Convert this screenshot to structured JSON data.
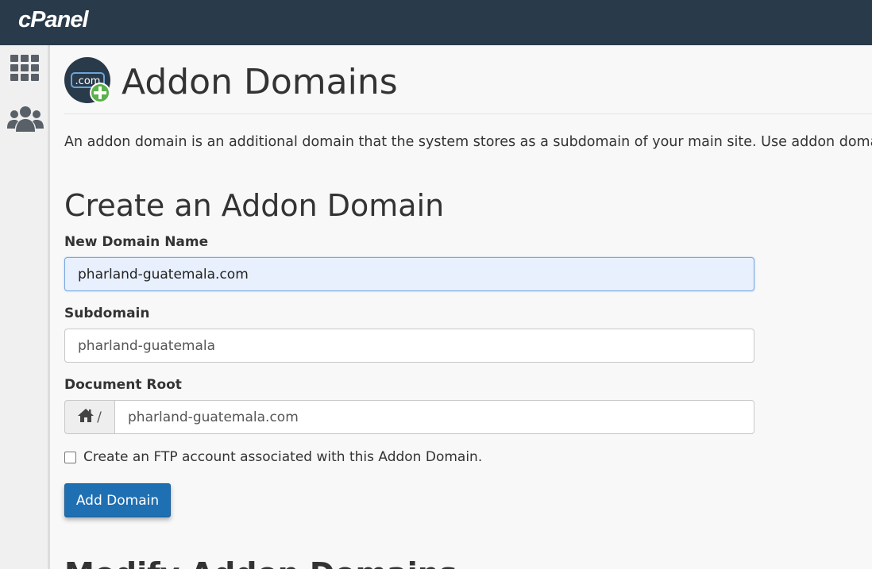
{
  "brand": {
    "logo_text": "cPanel"
  },
  "sidebar": {
    "items": [
      {
        "icon": "grid-icon"
      },
      {
        "icon": "users-icon"
      }
    ]
  },
  "page": {
    "title": "Addon Domains",
    "icon": "dotcom-add-icon",
    "icon_text": ".com",
    "description": "An addon domain is an additional domain that the system stores as a subdomain of your main site. Use addon domains to ho"
  },
  "form": {
    "section_title": "Create an Addon Domain",
    "new_domain_label": "New Domain Name",
    "new_domain_value": "pharland-guatemala.com",
    "subdomain_label": "Subdomain",
    "subdomain_value": "pharland-guatemala",
    "docroot_label": "Document Root",
    "docroot_prefix": "/",
    "docroot_value": "pharland-guatemala.com",
    "ftp_checkbox_label": "Create an FTP account associated with this Addon Domain.",
    "ftp_checked": false,
    "submit_label": "Add Domain"
  },
  "modify_section": {
    "title": "Modify Addon Domains"
  },
  "colors": {
    "topbar": "#293a4a",
    "primary_button": "#1f6fb3",
    "focus_field_bg": "#e8f0fe",
    "icon_green": "#5bb14b"
  }
}
